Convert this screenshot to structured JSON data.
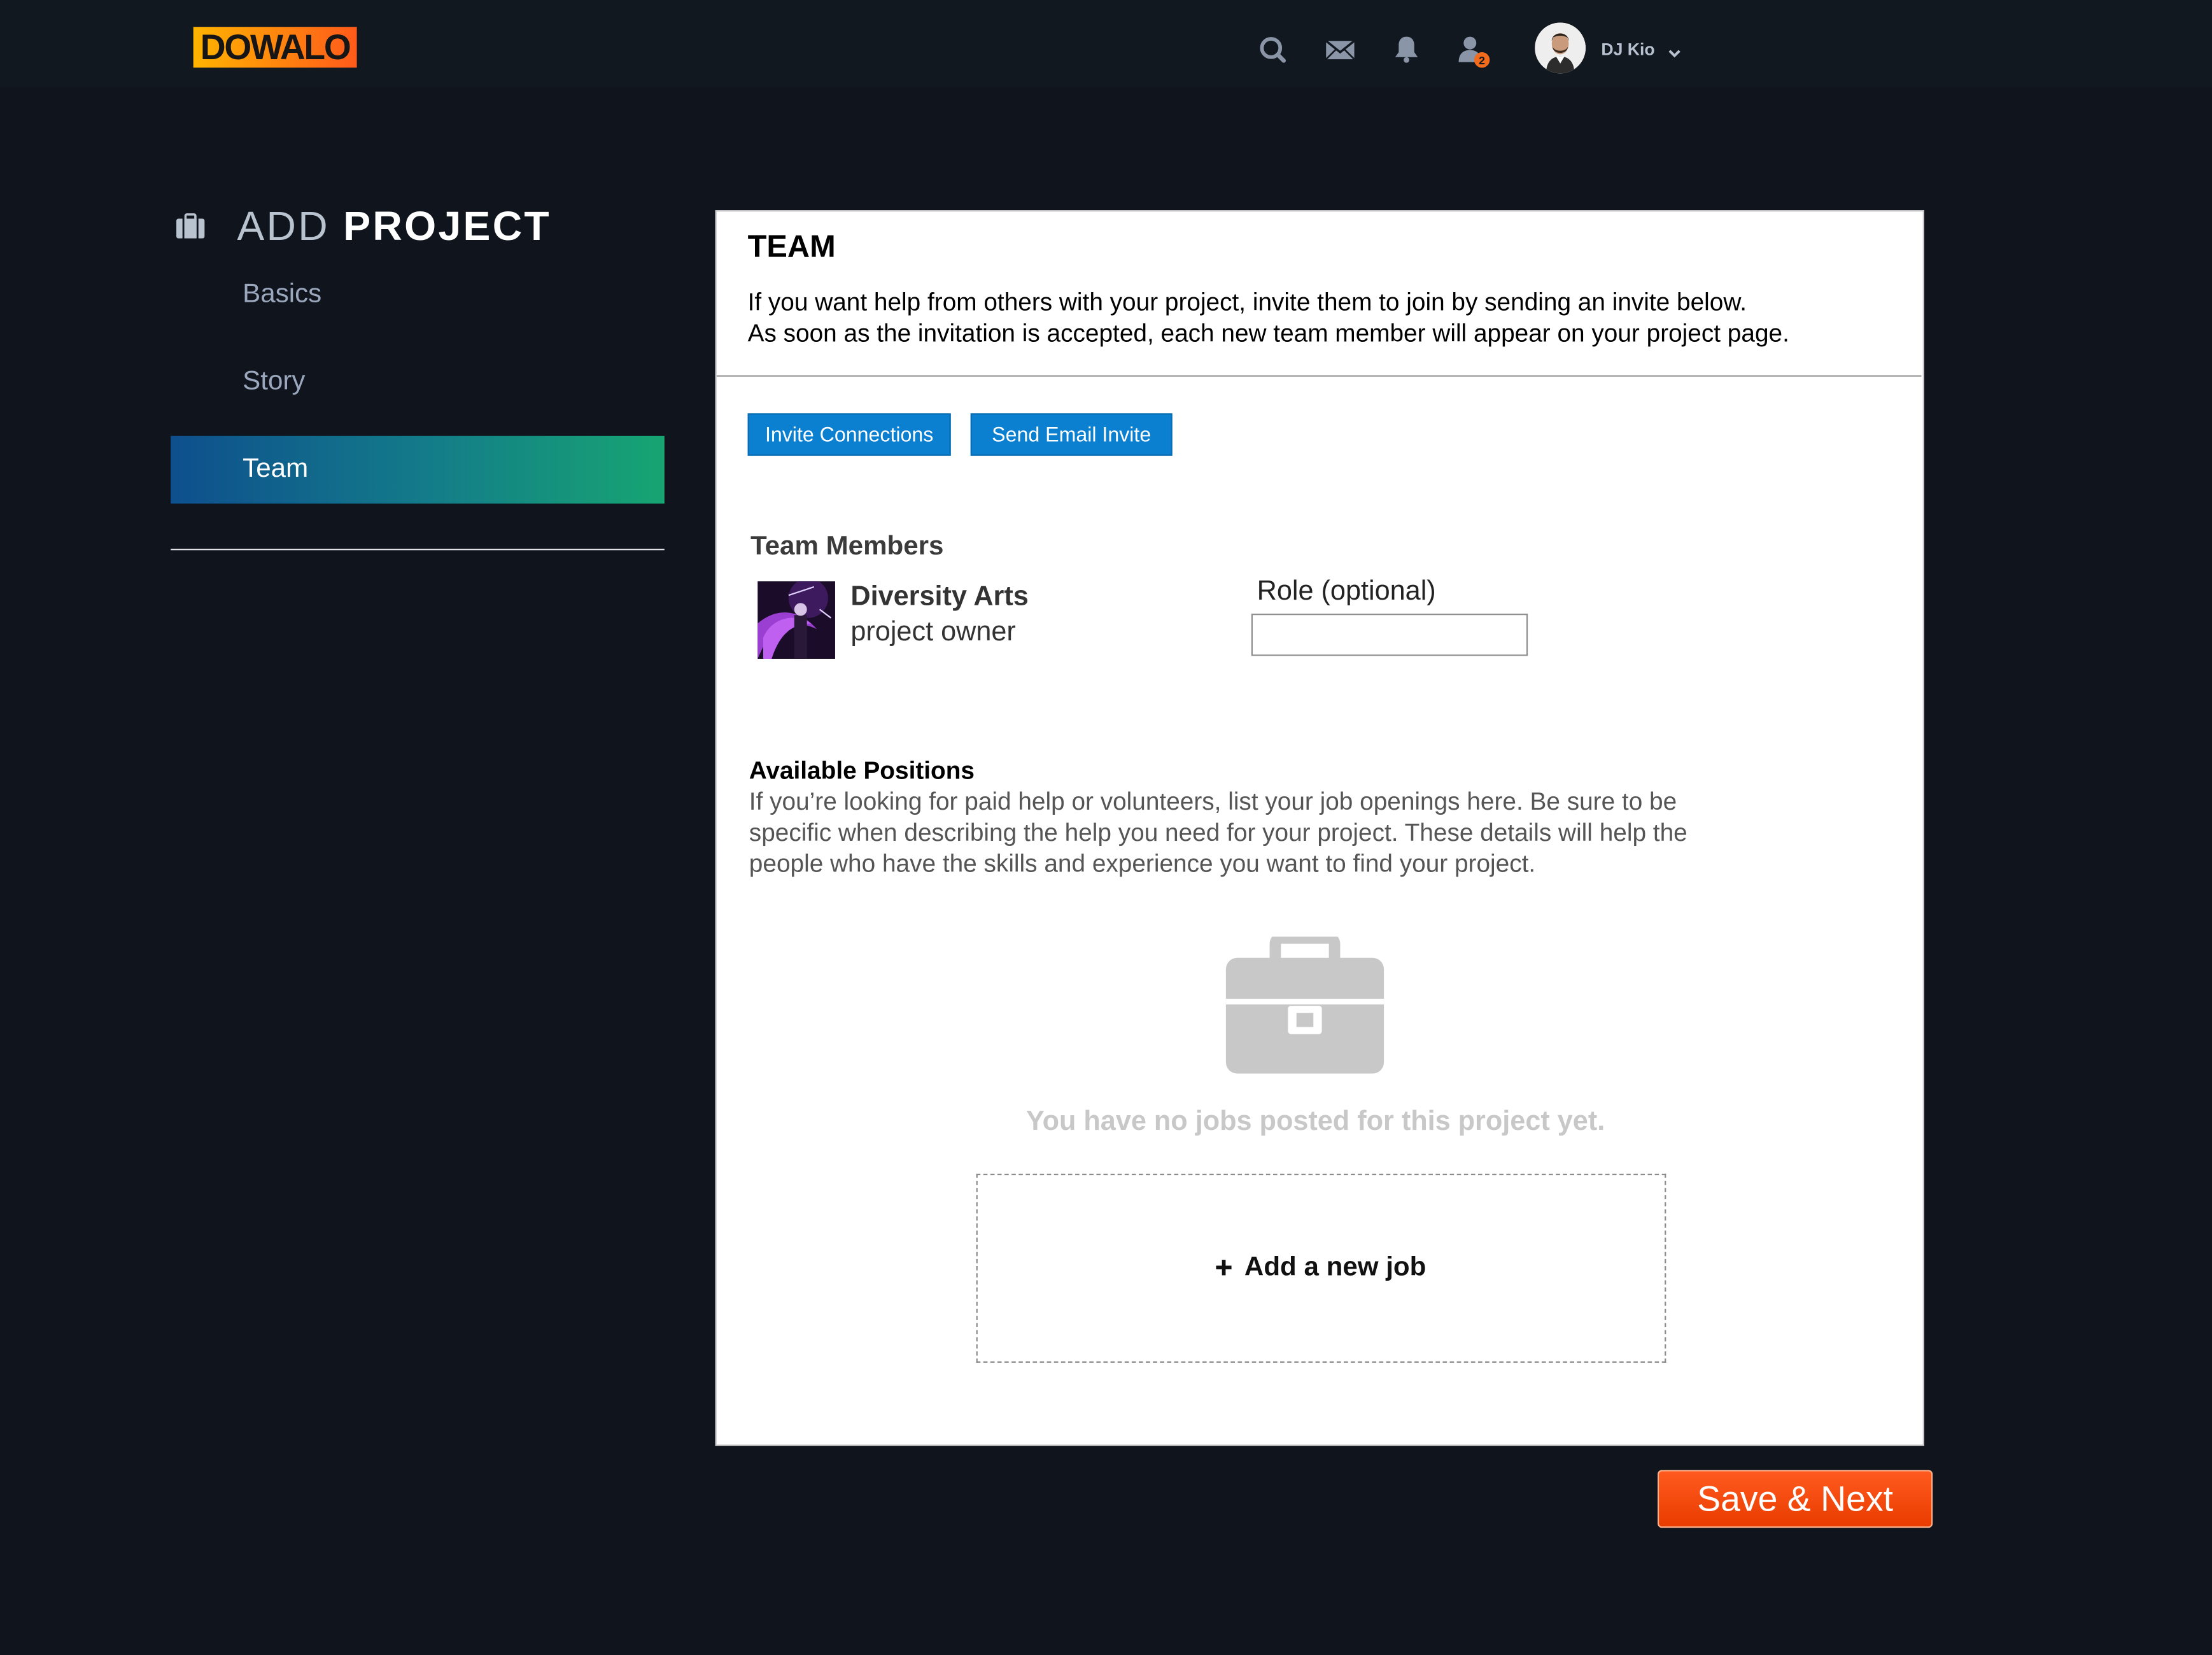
{
  "header": {
    "logo_text": "DOWALO",
    "user": {
      "name": "DJ Kio"
    },
    "icons": [
      "search-icon",
      "mail-icon",
      "bell-icon",
      "connections-icon"
    ],
    "notification_count": "2",
    "colors": {
      "bar": "#121820",
      "badge": "#f26a1b",
      "icon": "#8a96a8"
    }
  },
  "sidebar": {
    "title_light": "ADD",
    "title_bold": "PROJECT",
    "items": [
      {
        "label": "Basics",
        "active": false
      },
      {
        "label": "Story",
        "active": false
      },
      {
        "label": "Team",
        "active": true
      }
    ]
  },
  "team": {
    "title": "TEAM",
    "description_line1": "If you want help from others with your project, invite them to join by sending an invite below.",
    "description_line2": "As soon as the invitation is accepted, each new team member will appear on your project page.",
    "invite_connections_label": "Invite Connections",
    "send_email_label": "Send Email Invite",
    "members_title": "Team Members",
    "members": [
      {
        "name": "Diversity Arts",
        "role": "project owner"
      }
    ],
    "role_label": "Role (optional)",
    "role_value": ""
  },
  "positions": {
    "title": "Available Positions",
    "description": "If you’re looking for paid help or volunteers, list your job openings here. Be sure to be specific when describing the help you need for your project. These details will help the people who have the skills and experience you want to find your project.",
    "empty_message": "You have no jobs posted for this project yet.",
    "add_job_label": "Add a new job"
  },
  "footer": {
    "save_label": "Save & Next",
    "colors": {
      "save": "#f4511e",
      "primary_button": "#0b7fd0"
    }
  }
}
